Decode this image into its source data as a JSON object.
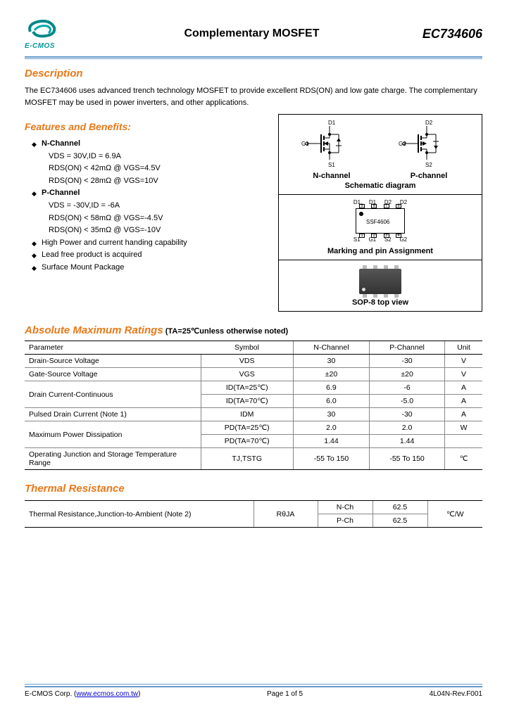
{
  "header": {
    "logo_text": "E-CMOS",
    "title": "Complementary  MOSFET",
    "part_number": "EC734606"
  },
  "description": {
    "title": "Description",
    "body": "The EC734606 uses advanced trench technology MOSFET to provide excellent RDS(ON) and low gate charge. The complementary MOSFET may be used in power inverters, and other applications."
  },
  "features": {
    "title": "Features and Benefits:",
    "items": [
      {
        "text": "N-Channel",
        "bold": true,
        "bullet": true
      },
      {
        "text": "VDS = 30V,ID = 6.9A",
        "sub": true
      },
      {
        "text": "RDS(ON) < 42mΩ @ VGS=4.5V",
        "sub": true
      },
      {
        "text": "RDS(ON) < 28mΩ @ VGS=10V",
        "sub": true
      },
      {
        "text": "P-Channel",
        "bold": true,
        "bullet": true
      },
      {
        "text": "VDS = -30V,ID = -6A",
        "sub": true
      },
      {
        "text": "RDS(ON) < 58mΩ @ VGS=-4.5V",
        "sub": true
      },
      {
        "text": "RDS(ON) < 35mΩ @ VGS=-10V",
        "sub": true
      },
      {
        "text": "High Power and current handing capability",
        "bullet": true
      },
      {
        "text": "Lead free product is acquired",
        "bullet": true
      },
      {
        "text": "Surface Mount Package",
        "bullet": true
      }
    ]
  },
  "diagram": {
    "d1": "D1",
    "d2": "D2",
    "g1": "G1",
    "g2": "G2",
    "s1": "S1",
    "s2": "S2",
    "nch": "N-channel",
    "pch": "P-channel",
    "schematic": "Schematic diagram",
    "chip_mark": "SSF4606",
    "pin_top": [
      "D1",
      "D1",
      "D2",
      "D2"
    ],
    "pin_bot": [
      "S1",
      "G1",
      "S2",
      "G2"
    ],
    "pin_num_top": [
      "5",
      "6",
      "7",
      "8"
    ],
    "pin_num_bot": [
      "1",
      "2",
      "3",
      "4"
    ],
    "marking": "Marking and pin Assignment",
    "sop": "SOP-8    top view"
  },
  "ratings": {
    "title": "Absolute Maximum  Ratings",
    "note": "(TA=25℃unless otherwise noted)",
    "headers": [
      "Parameter",
      "Symbol",
      "N-Channel",
      "P-Channel",
      "Unit"
    ],
    "rows": [
      {
        "param": "Drain-Source Voltage",
        "sym": "VDS",
        "n": "30",
        "p": "-30",
        "u": "V"
      },
      {
        "param": "Gate-Source Voltage",
        "sym": "VGS",
        "n": "±20",
        "p": "±20",
        "u": "V"
      },
      {
        "param": "Drain Current-Continuous",
        "sym": "ID(TA=25℃)",
        "n": "6.9",
        "p": "-6",
        "u": "A",
        "rowspan": true
      },
      {
        "param": "",
        "sym": "ID(TA=70℃)",
        "n": "6.0",
        "p": "-5.0",
        "u": "A"
      },
      {
        "param": "Pulsed Drain Current (Note 1)",
        "sym": "IDM",
        "n": "30",
        "p": "-30",
        "u": "A"
      },
      {
        "param": "Maximum Power Dissipation",
        "sym": "PD(TA=25℃)",
        "n": "2.0",
        "p": "2.0",
        "u": "W",
        "rowspan": true
      },
      {
        "param": "",
        "sym": "PD(TA=70℃)",
        "n": "1.44",
        "p": "1.44",
        "u": ""
      },
      {
        "param": "Operating Junction and Storage Temperature Range",
        "sym": "TJ,TSTG",
        "n": "-55 To 150",
        "p": "-55 To 150",
        "u": "℃"
      }
    ]
  },
  "thermal": {
    "title": "Thermal Resistance",
    "param": "Thermal Resistance,Junction-to-Ambient (Note 2)",
    "sym": "RθJA",
    "nch_label": "N-Ch",
    "pch_label": "P-Ch",
    "n": "62.5",
    "p": "62.5",
    "unit": "℃/W"
  },
  "footer": {
    "corp": "E-CMOS Corp. (",
    "link": "www.ecmos.com.tw",
    "corp_end": ")",
    "page": "Page 1 of 5",
    "rev": "4L04N-Rev.F001"
  }
}
